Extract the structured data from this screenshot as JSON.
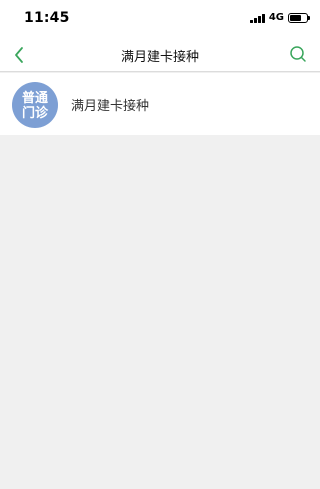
{
  "status_bar": {
    "time": "11:45",
    "network": "4G",
    "icons": [
      "signal-icon",
      "battery-icon"
    ]
  },
  "nav": {
    "title": "满月建卡接种",
    "back_icon": "chevron-left-icon",
    "search_icon": "search-icon",
    "accent_color": "#3aa65c"
  },
  "list": {
    "items": [
      {
        "label": "满月建卡接种",
        "avatar_text": "普通门诊",
        "avatar_color": "#7d9fd4"
      }
    ]
  }
}
